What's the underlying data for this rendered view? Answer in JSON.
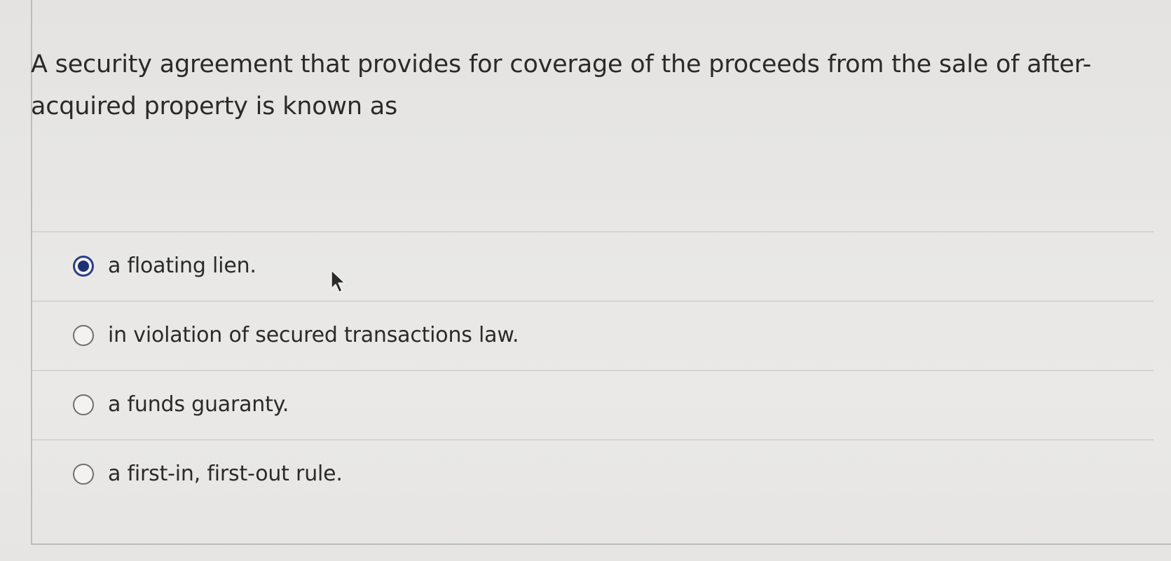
{
  "question": {
    "text": "A security agreement that provides for coverage of the proceeds from the sale of after-acquired property is known as"
  },
  "options": [
    {
      "label": "a floating lien.",
      "selected": true
    },
    {
      "label": "in violation of secured transactions law.",
      "selected": false
    },
    {
      "label": "a funds guaranty.",
      "selected": false
    },
    {
      "label": "a first-in, first-out rule.",
      "selected": false
    }
  ],
  "colors": {
    "selected_radio": "#2b3e8f",
    "text": "#2a2a2a",
    "divider": "#d5d4d2"
  },
  "icons": {
    "cursor": "mouse-pointer-icon"
  }
}
